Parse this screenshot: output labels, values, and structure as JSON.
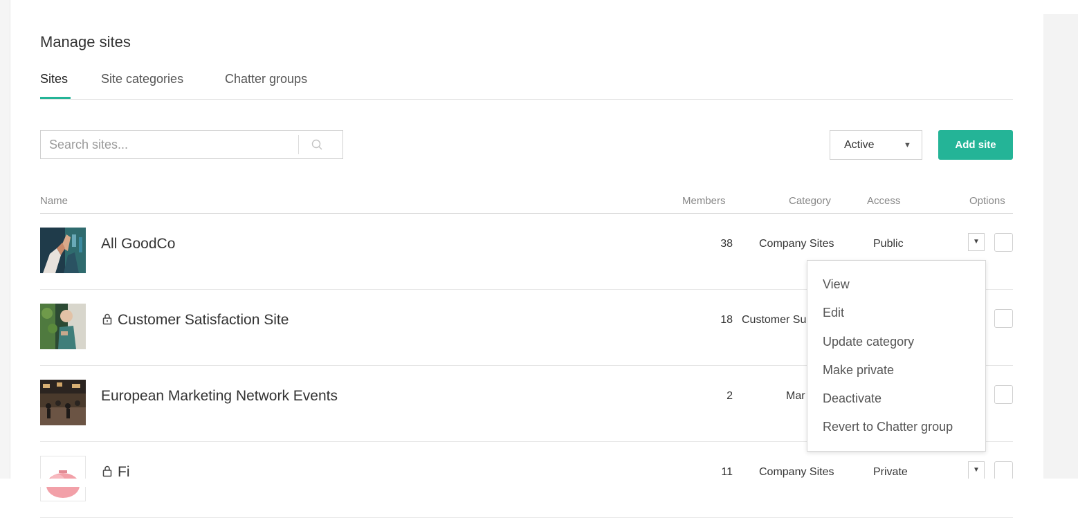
{
  "page": {
    "title": "Manage sites"
  },
  "tabs": [
    {
      "label": "Sites",
      "active": true
    },
    {
      "label": "Site categories",
      "active": false
    },
    {
      "label": "Chatter groups",
      "active": false
    }
  ],
  "search": {
    "placeholder": "Search sites...",
    "value": "",
    "icon": "search-icon"
  },
  "status_filter": {
    "selected": "Active"
  },
  "add_button": {
    "label": "Add site"
  },
  "accent_color": "#24b497",
  "table": {
    "headers": {
      "name": "Name",
      "members": "Members",
      "category": "Category",
      "access": "Access",
      "options": "Options"
    },
    "rows": [
      {
        "name": "All GoodCo",
        "locked": false,
        "members": "38",
        "category": "Company Sites",
        "access": "Public"
      },
      {
        "name": "Customer Satisfaction Site",
        "locked": true,
        "members": "18",
        "category": "Customer Su",
        "access": ""
      },
      {
        "name": "European Marketing Network Events",
        "locked": false,
        "members": "2",
        "category": "Mar",
        "access": ""
      },
      {
        "name": "Fi",
        "locked": true,
        "members": "11",
        "category": "Company Sites",
        "access": "Private"
      }
    ]
  },
  "options_menu": {
    "items": [
      "View",
      "Edit",
      "Update category",
      "Make private",
      "Deactivate",
      "Revert to Chatter group"
    ]
  }
}
